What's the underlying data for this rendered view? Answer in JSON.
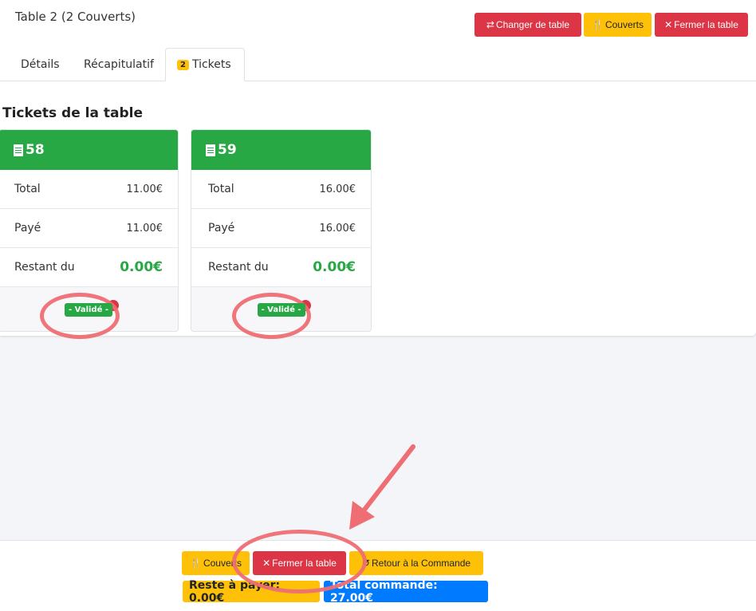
{
  "header": {
    "title": "Table 2 (2 Couverts)",
    "change_table": "Changer de table",
    "covers": "Couverts",
    "close_table": "Fermer la table"
  },
  "tabs": {
    "details": "Détails",
    "summary": "Récapitulatif",
    "tickets_count": "2",
    "tickets": "Tickets"
  },
  "section": {
    "title": "Tickets de la table"
  },
  "tickets": [
    {
      "number": "58",
      "total_label": "Total",
      "total": "11.00€",
      "paid_label": "Payé",
      "paid": "11.00€",
      "due_label": "Restant du",
      "due": "0.00€",
      "status": "- Validé -"
    },
    {
      "number": "59",
      "total_label": "Total",
      "total": "16.00€",
      "paid_label": "Payé",
      "paid": "16.00€",
      "due_label": "Restant du",
      "due": "0.00€",
      "status": "- Validé -"
    }
  ],
  "footer": {
    "covers": "Couverts",
    "close_table": "Fermer la table",
    "back": "Retour à la Commande",
    "remaining_label": "Reste à payer: 0.00€",
    "total_label": "Total commande: 27.00€"
  },
  "colors": {
    "accent_red": "#dc3545",
    "accent_yellow": "#ffc107",
    "accent_green": "#28a745",
    "accent_blue": "#007bff",
    "annotation": "#ee6e73"
  },
  "icons": [
    "exchange-icon",
    "utensils-icon",
    "close-icon",
    "receipt-icon",
    "undo-icon"
  ]
}
